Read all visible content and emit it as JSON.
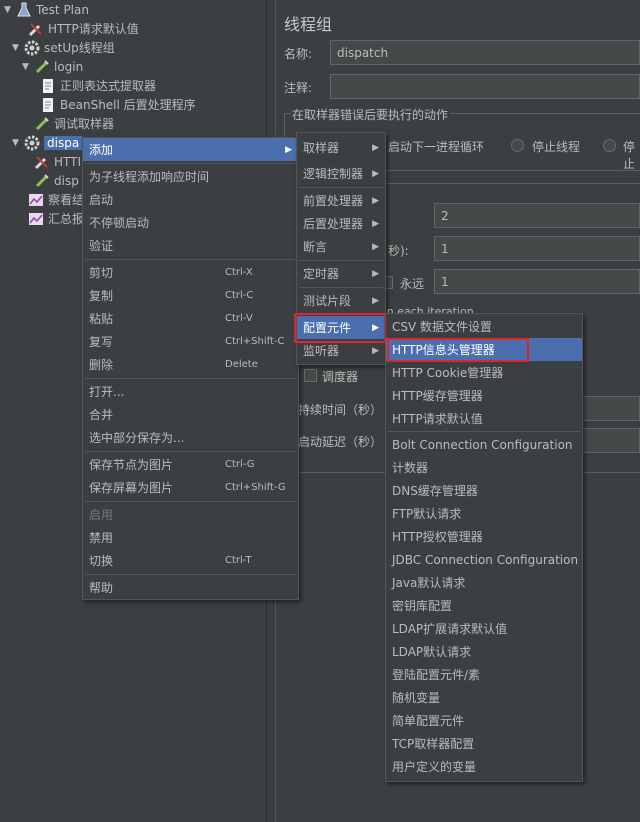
{
  "tree": {
    "test_plan": "Test Plan",
    "http_defaults": "HTTP请求默认值",
    "setup_group": "setUp线程组",
    "login": "login",
    "regex_extractor": "正则表达式提取器",
    "beanshell_post": "BeanShell 后置处理程序",
    "debug_sampler": "调试取样器",
    "dispatch": "dispa",
    "http_child": "HTTI",
    "dispatch_child": "disp",
    "results_tree": "察看结",
    "summary_report": "汇总报"
  },
  "panel": {
    "title": "线程组",
    "name_label": "名称:",
    "name_value": "dispatch",
    "comment_label": "注释:",
    "comment_value": "",
    "error_group_title": "在取样器错误后要执行的动作",
    "opt_next_loop": "启动下一进程循环",
    "opt_stop_thread": "停止线程",
    "opt_stop_more": "停止",
    "threads_value": "2",
    "rampup_suffix": "秒):",
    "rampup_value": "1",
    "forever_label": "永远",
    "loop_value": "1",
    "each_iteration": "on each iteration",
    "scheduler_label": "调度器",
    "duration_label": "持续时间（秒）",
    "delay_label": "启动延迟（秒）"
  },
  "context_menu": {
    "add": "添加",
    "add_response_time": "为子线程添加响应时间",
    "start": "启动",
    "start_no_pause": "不停顿启动",
    "validate": "验证",
    "cut": "剪切",
    "cut_key": "Ctrl-X",
    "copy": "复制",
    "copy_key": "Ctrl-C",
    "paste": "粘贴",
    "paste_key": "Ctrl-V",
    "duplicate": "复写",
    "duplicate_key": "Ctrl+Shift-C",
    "delete": "删除",
    "delete_key": "Delete",
    "open": "打开...",
    "merge": "合并",
    "save_selection": "选中部分保存为...",
    "save_node_image": "保存节点为图片",
    "save_node_image_key": "Ctrl-G",
    "save_screen_image": "保存屏幕为图片",
    "save_screen_image_key": "Ctrl+Shift-G",
    "enable": "启用",
    "disable": "禁用",
    "toggle": "切换",
    "toggle_key": "Ctrl-T",
    "help": "帮助"
  },
  "add_menu": {
    "sampler": "取样器",
    "logic_controller": "逻辑控制器",
    "pre_processor": "前置处理器",
    "post_processor": "后置处理器",
    "assertion": "断言",
    "timer": "定时器",
    "test_fragment": "测试片段",
    "config_element": "配置元件",
    "listener": "监听器"
  },
  "config_menu": {
    "items": [
      "CSV 数据文件设置",
      "HTTP信息头管理器",
      "HTTP Cookie管理器",
      "HTTP缓存管理器",
      "HTTP请求默认值",
      "Bolt Connection Configuration",
      "计数器",
      "DNS缓存管理器",
      "FTP默认请求",
      "HTTP授权管理器",
      "JDBC Connection Configuration",
      "Java默认请求",
      "密钥库配置",
      "LDAP扩展请求默认值",
      "LDAP默认请求",
      "登陆配置元件/素",
      "随机变量",
      "简单配置元件",
      "TCP取样器配置",
      "用户定义的变量"
    ]
  },
  "colors": {
    "background": "#3c3f41",
    "selection": "#4b6eaf",
    "highlight_box": "#e0242b"
  }
}
